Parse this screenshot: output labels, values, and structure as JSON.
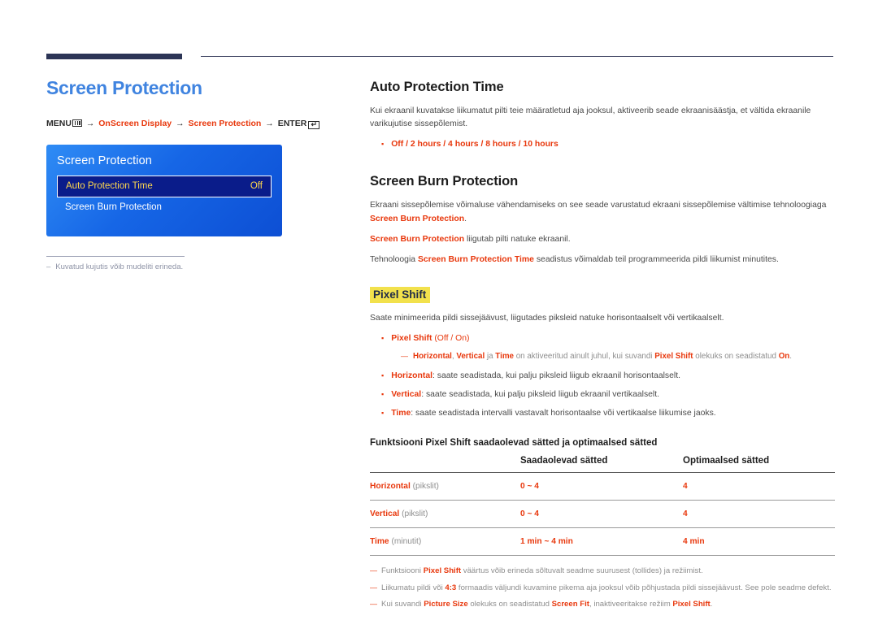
{
  "left": {
    "title": "Screen Protection",
    "breadcrumb": {
      "menu_label": "MENU",
      "menu_icon": "menu-bars-icon",
      "arrow": "→",
      "step1": "OnScreen Display",
      "step2": "Screen Protection",
      "enter_label": "ENTER",
      "enter_icon": "enter-return-icon",
      "enter_glyph": "↵"
    },
    "osd": {
      "title": "Screen Protection",
      "rows": [
        {
          "label": "Auto Protection Time",
          "value": "Off",
          "selected": true
        },
        {
          "label": "Screen Burn Protection",
          "value": "",
          "selected": false
        }
      ]
    },
    "note": {
      "dash": "–",
      "text": "Kuvatud kujutis võib mudeliti erineda."
    }
  },
  "right": {
    "auto_protection": {
      "heading": "Auto Protection Time",
      "paragraph": "Kui ekraanil kuvatakse liikumatut pilti teie määratletud aja jooksul, aktiveerib seade ekraanisäästja, et vältida ekraanile varikujutise sissepõlemist.",
      "options": "Off / 2 hours / 4 hours / 8 hours / 10 hours"
    },
    "burn_protection": {
      "heading": "Screen Burn Protection",
      "p1_a": "Ekraani sissepõlemise võimaluse vähendamiseks on see seade varustatud ekraani sissepõlemise vältimise tehnoloogiaga ",
      "p1_term": "Screen Burn Protection",
      "p1_b": ".",
      "p2_term": "Screen Burn Protection",
      "p2_text": " liigutab pilti natuke ekraanil.",
      "p3_a": "Tehnoloogia ",
      "p3_term": "Screen Burn Protection Time",
      "p3_b": " seadistus võimaldab teil programmeerida pildi liikumist minutites."
    },
    "pixel_shift": {
      "heading": "Pixel Shift",
      "intro": "Saate minimeerida pildi sissejäävust, liigutades piksleid natuke horisontaalselt või vertikaalselt.",
      "bullet0_term": "Pixel Shift",
      "bullet0_opts": "(Off / On)",
      "subnote": {
        "dash": "—",
        "t1": "Horizontal",
        "sep1": ", ",
        "t2": "Vertical",
        "sep2": " ja ",
        "t3": "Time",
        "mid": " on aktiveeritud ainult juhul, kui suvandi ",
        "t4": "Pixel Shift",
        "mid2": " olekuks on seadistatud ",
        "t5": "On",
        "end": "."
      },
      "bullets": [
        {
          "term": "Horizontal",
          "text": ": saate seadistada, kui palju piksleid liigub ekraanil horisontaalselt."
        },
        {
          "term": "Vertical",
          "text": ": saate seadistada, kui palju piksleid liigub ekraanil vertikaalselt."
        },
        {
          "term": "Time",
          "text": ": saate seadistada intervalli vastavalt horisontaalse või vertikaalse liikumise jaoks."
        }
      ]
    },
    "table": {
      "caption": "Funktsiooni Pixel Shift saadaolevad sätted ja optimaalsed sätted",
      "headers": [
        "",
        "Saadaolevad sätted",
        "Optimaalsed sätted"
      ],
      "rows": [
        {
          "term": "Horizontal",
          "unit": "(pikslit)",
          "available": "0 ~ 4",
          "optimal": "4"
        },
        {
          "term": "Vertical",
          "unit": "(pikslit)",
          "available": "0 ~ 4",
          "optimal": "4"
        },
        {
          "term": "Time",
          "unit": "(minutit)",
          "available": "1 min ~ 4 min",
          "optimal": "4 min"
        }
      ]
    },
    "footnotes": [
      {
        "dash": "—",
        "a": "Funktsiooni ",
        "t1": "Pixel Shift",
        "b": " väärtus võib erineda sõltuvalt seadme suurusest (tollides) ja režiimist.",
        "t2": "",
        "c": "",
        "t3": "",
        "d": ""
      },
      {
        "dash": "—",
        "a": "Liikumatu pildi või ",
        "t1": "4:3",
        "b": " formaadis väljundi kuvamine pikema aja jooksul võib põhjustada pildi sissejäävust. See pole seadme defekt.",
        "t2": "",
        "c": "",
        "t3": "",
        "d": ""
      },
      {
        "dash": "—",
        "a": "Kui suvandi ",
        "t1": "Picture Size",
        "b": " olekuks on seadistatud ",
        "t2": "Screen Fit",
        "c": ", inaktiveeritakse režiim ",
        "t3": "Pixel Shift",
        "d": "."
      }
    ]
  },
  "colors": {
    "accent_red": "#e8380d",
    "title_blue": "#4084e0",
    "navy": "#2c3556",
    "highlight_yellow": "#f2e14c",
    "osd_blue": "#1666e6",
    "osd_selected": "#0a1c8a",
    "osd_gold": "#ffd84d"
  }
}
